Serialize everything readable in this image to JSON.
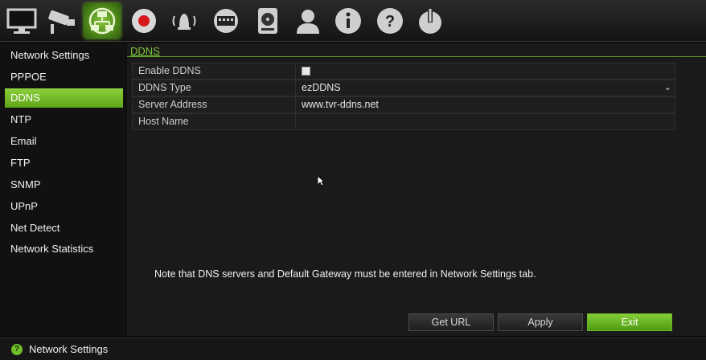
{
  "toolbar": {
    "icons": [
      "monitor-icon",
      "camera-icon",
      "network-icon",
      "record-icon",
      "alarm-icon",
      "device-icon",
      "hdd-icon",
      "user-icon",
      "info-icon",
      "help-icon",
      "power-icon"
    ],
    "active": "network-icon",
    "accent": "#6fbf2a"
  },
  "sidebar": {
    "items": [
      {
        "label": "Network Settings"
      },
      {
        "label": "PPPOE"
      },
      {
        "label": "DDNS"
      },
      {
        "label": "NTP"
      },
      {
        "label": "Email"
      },
      {
        "label": "FTP"
      },
      {
        "label": "SNMP"
      },
      {
        "label": "UPnP"
      },
      {
        "label": "Net Detect"
      },
      {
        "label": "Network Statistics"
      }
    ],
    "active_index": 2
  },
  "main": {
    "tab_label": "DDNS",
    "fields": [
      {
        "label": "Enable DDNS",
        "value": "",
        "type": "checkbox",
        "checked": false
      },
      {
        "label": "DDNS Type",
        "value": "ezDDNS",
        "type": "select"
      },
      {
        "label": "Server Address",
        "value": "www.tvr-ddns.net",
        "type": "text"
      },
      {
        "label": "Host Name",
        "value": "",
        "type": "text"
      }
    ],
    "note": "Note that DNS servers and Default Gateway must be entered in Network Settings tab.",
    "buttons": {
      "get_url": "Get URL",
      "apply": "Apply",
      "exit": "Exit"
    }
  },
  "statusbar": {
    "icon": "question-icon",
    "text": "Network Settings"
  }
}
